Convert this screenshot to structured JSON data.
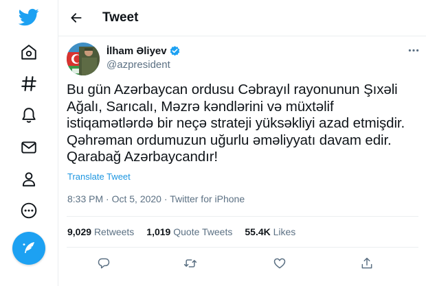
{
  "nav": {
    "items": [
      {
        "icon": "twitter-logo-icon"
      },
      {
        "icon": "home-icon"
      },
      {
        "icon": "explore-hashtag-icon"
      },
      {
        "icon": "notifications-bell-icon"
      },
      {
        "icon": "messages-envelope-icon"
      },
      {
        "icon": "profile-icon"
      },
      {
        "icon": "more-circle-icon"
      }
    ],
    "compose_icon": "compose-tweet-icon"
  },
  "header": {
    "title": "Tweet",
    "back_icon": "back-arrow-icon"
  },
  "tweet": {
    "author_name": "İlham Əliyev",
    "handle": "@azpresident",
    "text": "Bu gün Azərbaycan ordusu Cəbrayıl rayonunun Şıxəli\nAğalı, Sarıcalı, Məzrə kəndlərini və müxtəlif\nistiqamətlərdə bir neçə strateji yüksəkliyi azad etmişdir.\nQəhrəman ordumuzun uğurlu əməliyyatı davam edir.\nQarabağ Azərbaycandır!",
    "translate_label": "Translate Tweet",
    "time": "8:33 PM",
    "date": "Oct 5, 2020",
    "source": "Twitter for iPhone",
    "separator": "·"
  },
  "stats": {
    "retweets_count": "9,029",
    "retweets_label": "Retweets",
    "quotes_count": "1,019",
    "quotes_label": "Quote Tweets",
    "likes_count": "55.4K",
    "likes_label": "Likes"
  },
  "colors": {
    "brand": "#1da1f2",
    "link": "#1b95e0",
    "secondary_text": "#5b7083",
    "primary_text": "#0f1419",
    "border": "#ebeef0"
  }
}
